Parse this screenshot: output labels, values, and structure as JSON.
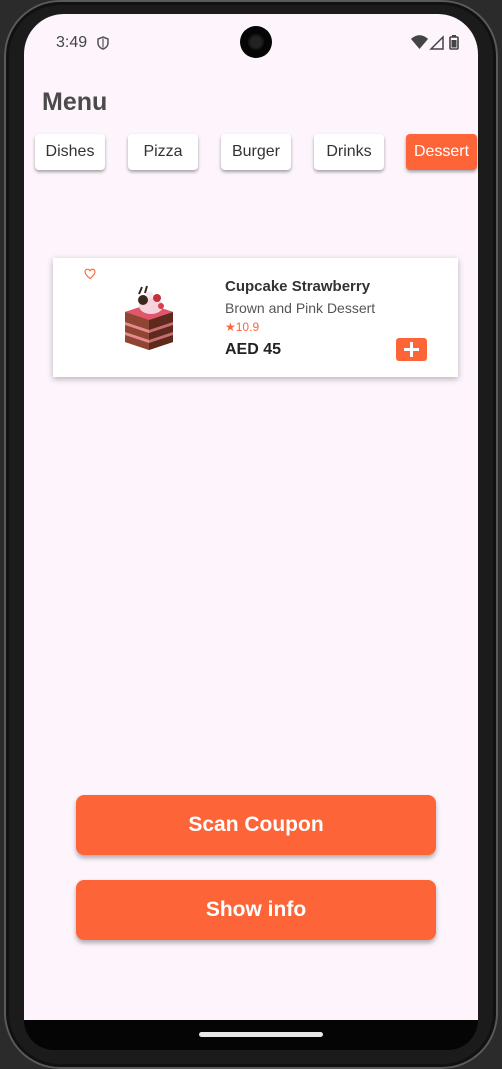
{
  "status_bar": {
    "time": "3:49",
    "icons": [
      "shield-icon",
      "wifi-icon",
      "signal-icon",
      "battery-icon"
    ]
  },
  "page": {
    "title": "Menu"
  },
  "categories": [
    {
      "label": "Dishes",
      "active": false
    },
    {
      "label": "Pizza",
      "active": false
    },
    {
      "label": "Burger",
      "active": false
    },
    {
      "label": "Drinks",
      "active": false
    },
    {
      "label": "Dessert",
      "active": true
    }
  ],
  "items": [
    {
      "name": "Cupcake Strawberry",
      "description": "Brown and Pink Dessert",
      "rating": "★10.9",
      "price": "AED 45",
      "favorite_icon": "heart-outline-icon",
      "add_icon": "plus-icon"
    }
  ],
  "buttons": {
    "scan_coupon": "Scan Coupon",
    "show_info": "Show info"
  },
  "colors": {
    "accent": "#fd6539",
    "background": "#fdf4fc",
    "card": "#ffffff"
  }
}
